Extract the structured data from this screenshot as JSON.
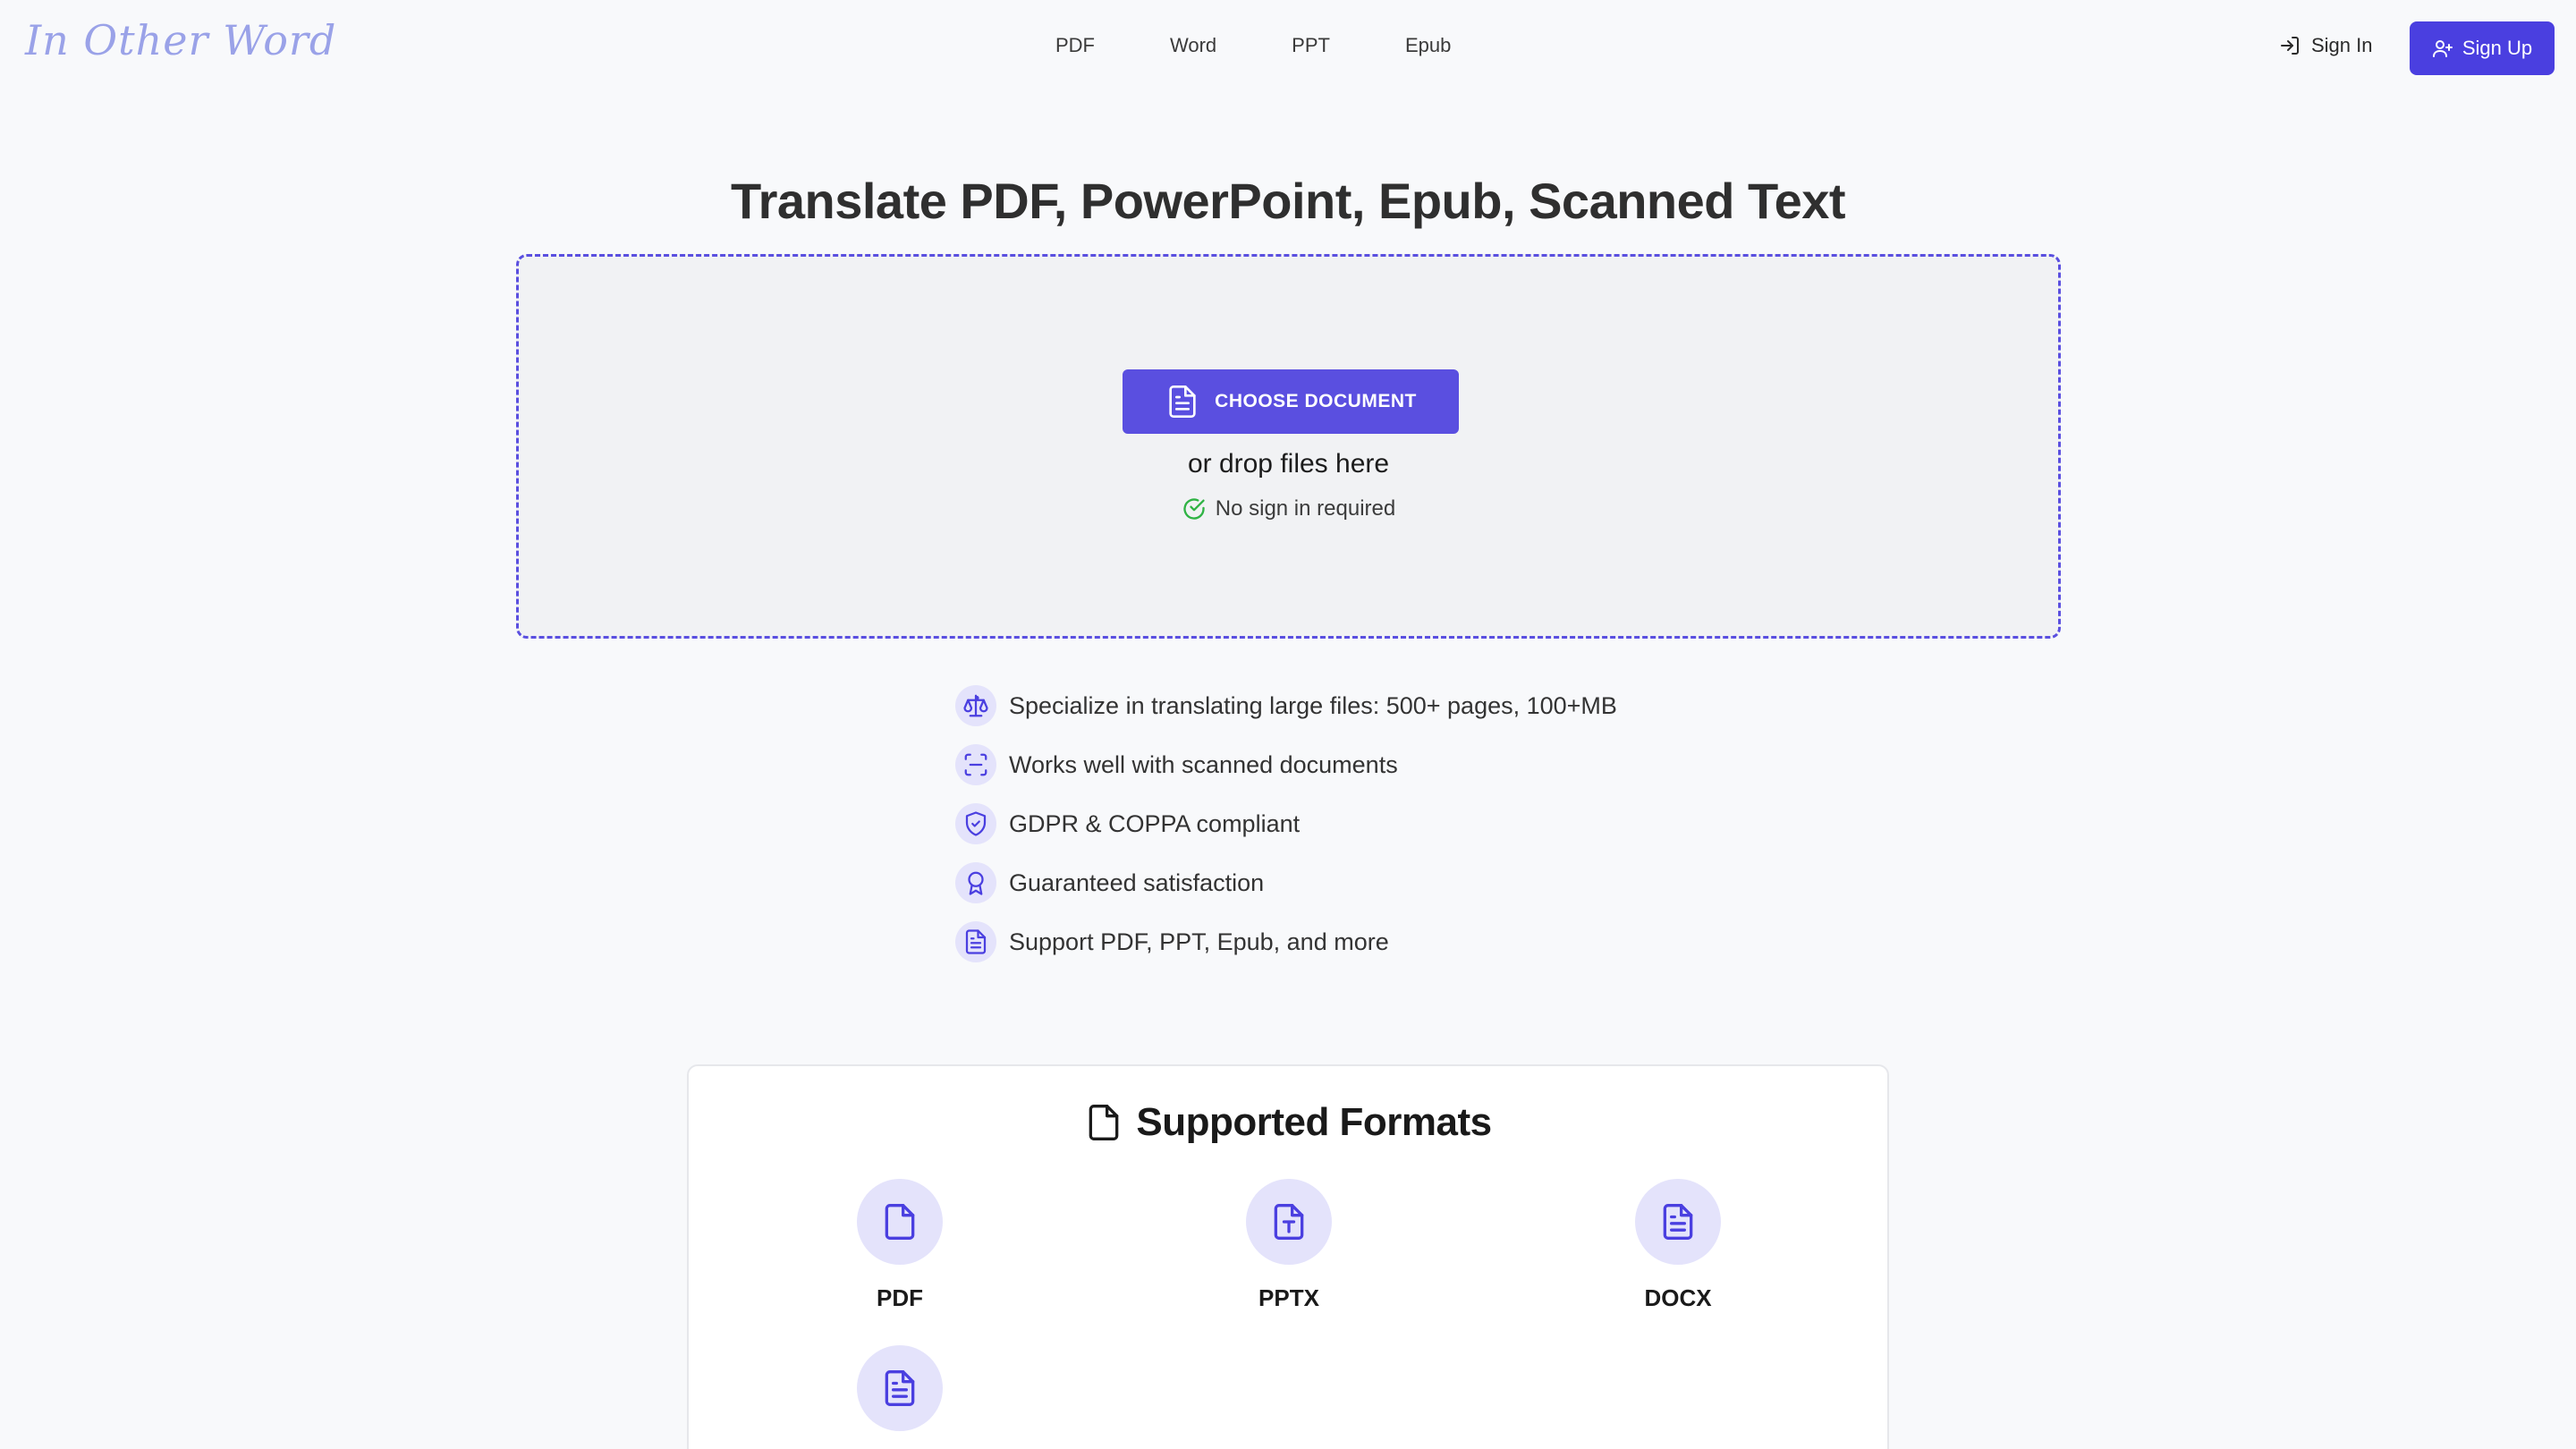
{
  "header": {
    "logo": "In Other Word",
    "nav": [
      "PDF",
      "Word",
      "PPT",
      "Epub"
    ],
    "sign_in": "Sign In",
    "sign_up": "Sign Up"
  },
  "hero": {
    "title": "Translate PDF, PowerPoint, Epub, Scanned Text",
    "choose_button": "CHOOSE DOCUMENT",
    "drop_text": "or drop files here",
    "no_sign_in": "No sign in required"
  },
  "features": [
    {
      "icon": "scale-icon",
      "text": "Specialize in translating large files: 500+ pages, 100+MB"
    },
    {
      "icon": "scan-icon",
      "text": "Works well with scanned documents"
    },
    {
      "icon": "shield-check-icon",
      "text": "GDPR & COPPA compliant"
    },
    {
      "icon": "award-icon",
      "text": "Guaranteed satisfaction"
    },
    {
      "icon": "document-icon",
      "text": "Support PDF, PPT, Epub, and more"
    }
  ],
  "formats": {
    "title": "Supported Formats",
    "items": [
      {
        "icon": "file-icon",
        "label": "PDF"
      },
      {
        "icon": "presentation-file-icon",
        "label": "PPTX"
      },
      {
        "icon": "document-icon",
        "label": "DOCX"
      },
      {
        "icon": "document-icon",
        "label": ""
      }
    ]
  },
  "colors": {
    "accent": "#5a4fe0",
    "signup_bg": "#4a3fe0",
    "icon_bg": "#e4e3fb",
    "success": "#2fb344",
    "logo": "#9aa2e8"
  }
}
